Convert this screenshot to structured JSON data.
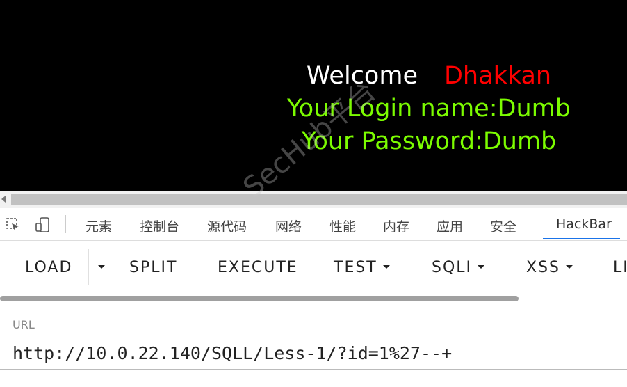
{
  "page": {
    "welcome": "Welcome",
    "username": "Dhakkan",
    "login_line": "Your Login name:Dumb",
    "password_line": "Your Password:Dumb",
    "watermark": "SecHub平台"
  },
  "devtools": {
    "tabs": [
      "元素",
      "控制台",
      "源代码",
      "网络",
      "性能",
      "内存",
      "应用",
      "安全",
      "HackBar"
    ],
    "active_tab": "HackBar"
  },
  "hackbar": {
    "buttons": {
      "load": "LOAD",
      "split": "SPLIT",
      "execute": "EXECUTE",
      "test": "TEST",
      "sqli": "SQLI",
      "xss": "XSS",
      "more": "LI"
    },
    "url_label": "URL",
    "url_value": "http://10.0.22.140/SQLL/Less-1/?id=1%27--+"
  },
  "colors": {
    "page_bg": "#000000",
    "welcome": "#ffffff",
    "username": "#ff0000",
    "info": "#7CFC00",
    "active_tab_underline": "#1a73e8"
  }
}
